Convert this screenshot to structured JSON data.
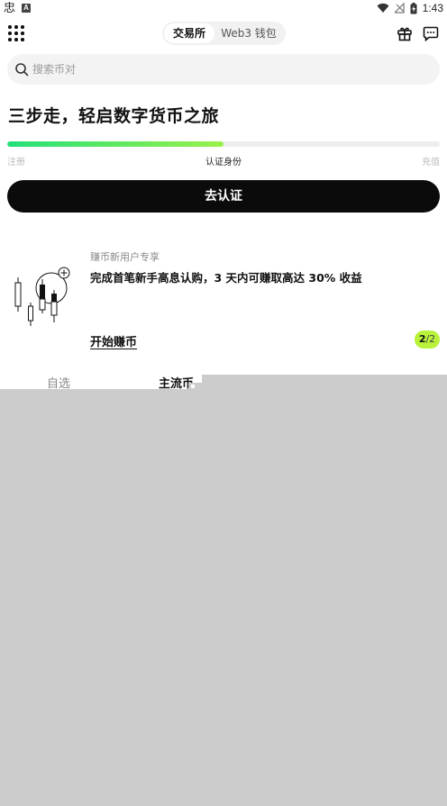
{
  "status_bar": {
    "left_glyph": "忠",
    "a_badge": "A",
    "time": "1:43",
    "icons": [
      "wifi-icon",
      "no-signal-icon",
      "battery-charging-icon"
    ]
  },
  "header": {
    "menu_icon": "grid-menu-icon",
    "tabs": [
      {
        "label": "交易所",
        "active": true
      },
      {
        "label": "Web3 钱包",
        "active": false
      }
    ],
    "right_icons": [
      "gift-icon",
      "chat-icon"
    ]
  },
  "search": {
    "placeholder": "搜索币对"
  },
  "onboarding": {
    "title": "三步走，轻启数字货币之旅",
    "progress": 0.5,
    "steps": [
      "注册",
      "认证身份",
      "充值"
    ],
    "current_step": 2,
    "cta_label": "去认证"
  },
  "promo": {
    "tag": "赚币新用户专享",
    "text": "完成首笔新手高息认购，3 天内可赚取高达 30% 收益",
    "link_label": "开始赚币",
    "page_current": "2",
    "page_sep_total": "/2"
  },
  "market_tabs": [
    {
      "label": "自选",
      "active": false
    },
    {
      "label": "主流币",
      "active": true
    }
  ],
  "colors": {
    "accent_lime": "#b8f23b",
    "progress_start": "#22e07a",
    "progress_end": "#9af04a",
    "cta_bg": "#0b0b0b",
    "overlay": "#cccccc"
  }
}
